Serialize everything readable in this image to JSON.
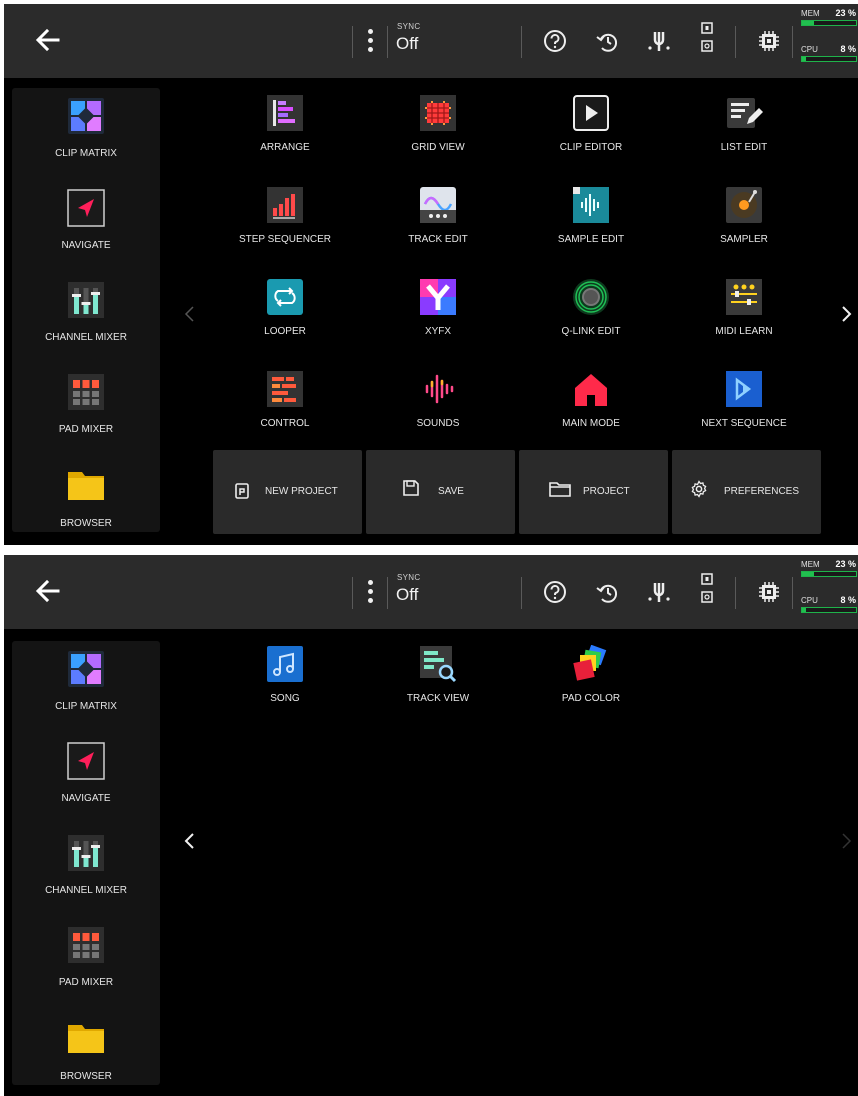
{
  "topbar": {
    "back": "back-arrow-icon",
    "sync_label": "SYNC",
    "sync_value": "Off",
    "icons": [
      "help-icon",
      "undo-history-icon",
      "tuner-icon",
      "input-output-icon",
      "cpu-chip-icon"
    ],
    "mem_label": "MEM",
    "mem_value": "23 %",
    "mem_percent": 23,
    "cpu_label": "CPU",
    "cpu_value": "8 %",
    "cpu_percent": 8,
    "meter_color": "#21c04f"
  },
  "sidebar": [
    {
      "label": "CLIP MATRIX",
      "icon": "clip-matrix-icon"
    },
    {
      "label": "NAVIGATE",
      "icon": "navigate-icon"
    },
    {
      "label": "CHANNEL MIXER",
      "icon": "channel-mixer-icon"
    },
    {
      "label": "PAD MIXER",
      "icon": "pad-mixer-icon"
    },
    {
      "label": "BROWSER",
      "icon": "browser-folder-icon"
    }
  ],
  "page1": {
    "items": [
      {
        "label": "ARRANGE",
        "icon": "arrange-icon"
      },
      {
        "label": "GRID VIEW",
        "icon": "grid-view-icon"
      },
      {
        "label": "CLIP EDITOR",
        "icon": "clip-editor-icon"
      },
      {
        "label": "LIST EDIT",
        "icon": "list-edit-icon"
      },
      {
        "label": "STEP SEQUENCER",
        "icon": "step-sequencer-icon"
      },
      {
        "label": "TRACK EDIT",
        "icon": "track-edit-icon"
      },
      {
        "label": "SAMPLE EDIT",
        "icon": "sample-edit-icon"
      },
      {
        "label": "SAMPLER",
        "icon": "sampler-icon"
      },
      {
        "label": "LOOPER",
        "icon": "looper-icon"
      },
      {
        "label": "XYFX",
        "icon": "xyfx-icon"
      },
      {
        "label": "Q-LINK EDIT",
        "icon": "q-link-edit-icon"
      },
      {
        "label": "MIDI LEARN",
        "icon": "midi-learn-icon"
      },
      {
        "label": "CONTROL",
        "icon": "control-icon"
      },
      {
        "label": "SOUNDS",
        "icon": "sounds-icon"
      },
      {
        "label": "MAIN MODE",
        "icon": "main-mode-icon"
      },
      {
        "label": "NEXT SEQUENCE",
        "icon": "next-sequence-icon"
      }
    ],
    "actions": [
      {
        "label": "NEW PROJECT",
        "icon": "new-project-icon"
      },
      {
        "label": "SAVE",
        "icon": "save-icon"
      },
      {
        "label": "PROJECT",
        "icon": "project-folder-icon"
      },
      {
        "label": "PREFERENCES",
        "icon": "gear-icon"
      }
    ]
  },
  "page2": {
    "items": [
      {
        "label": "SONG",
        "icon": "song-icon"
      },
      {
        "label": "TRACK VIEW",
        "icon": "track-view-icon"
      },
      {
        "label": "PAD COLOR",
        "icon": "pad-color-icon"
      }
    ]
  }
}
